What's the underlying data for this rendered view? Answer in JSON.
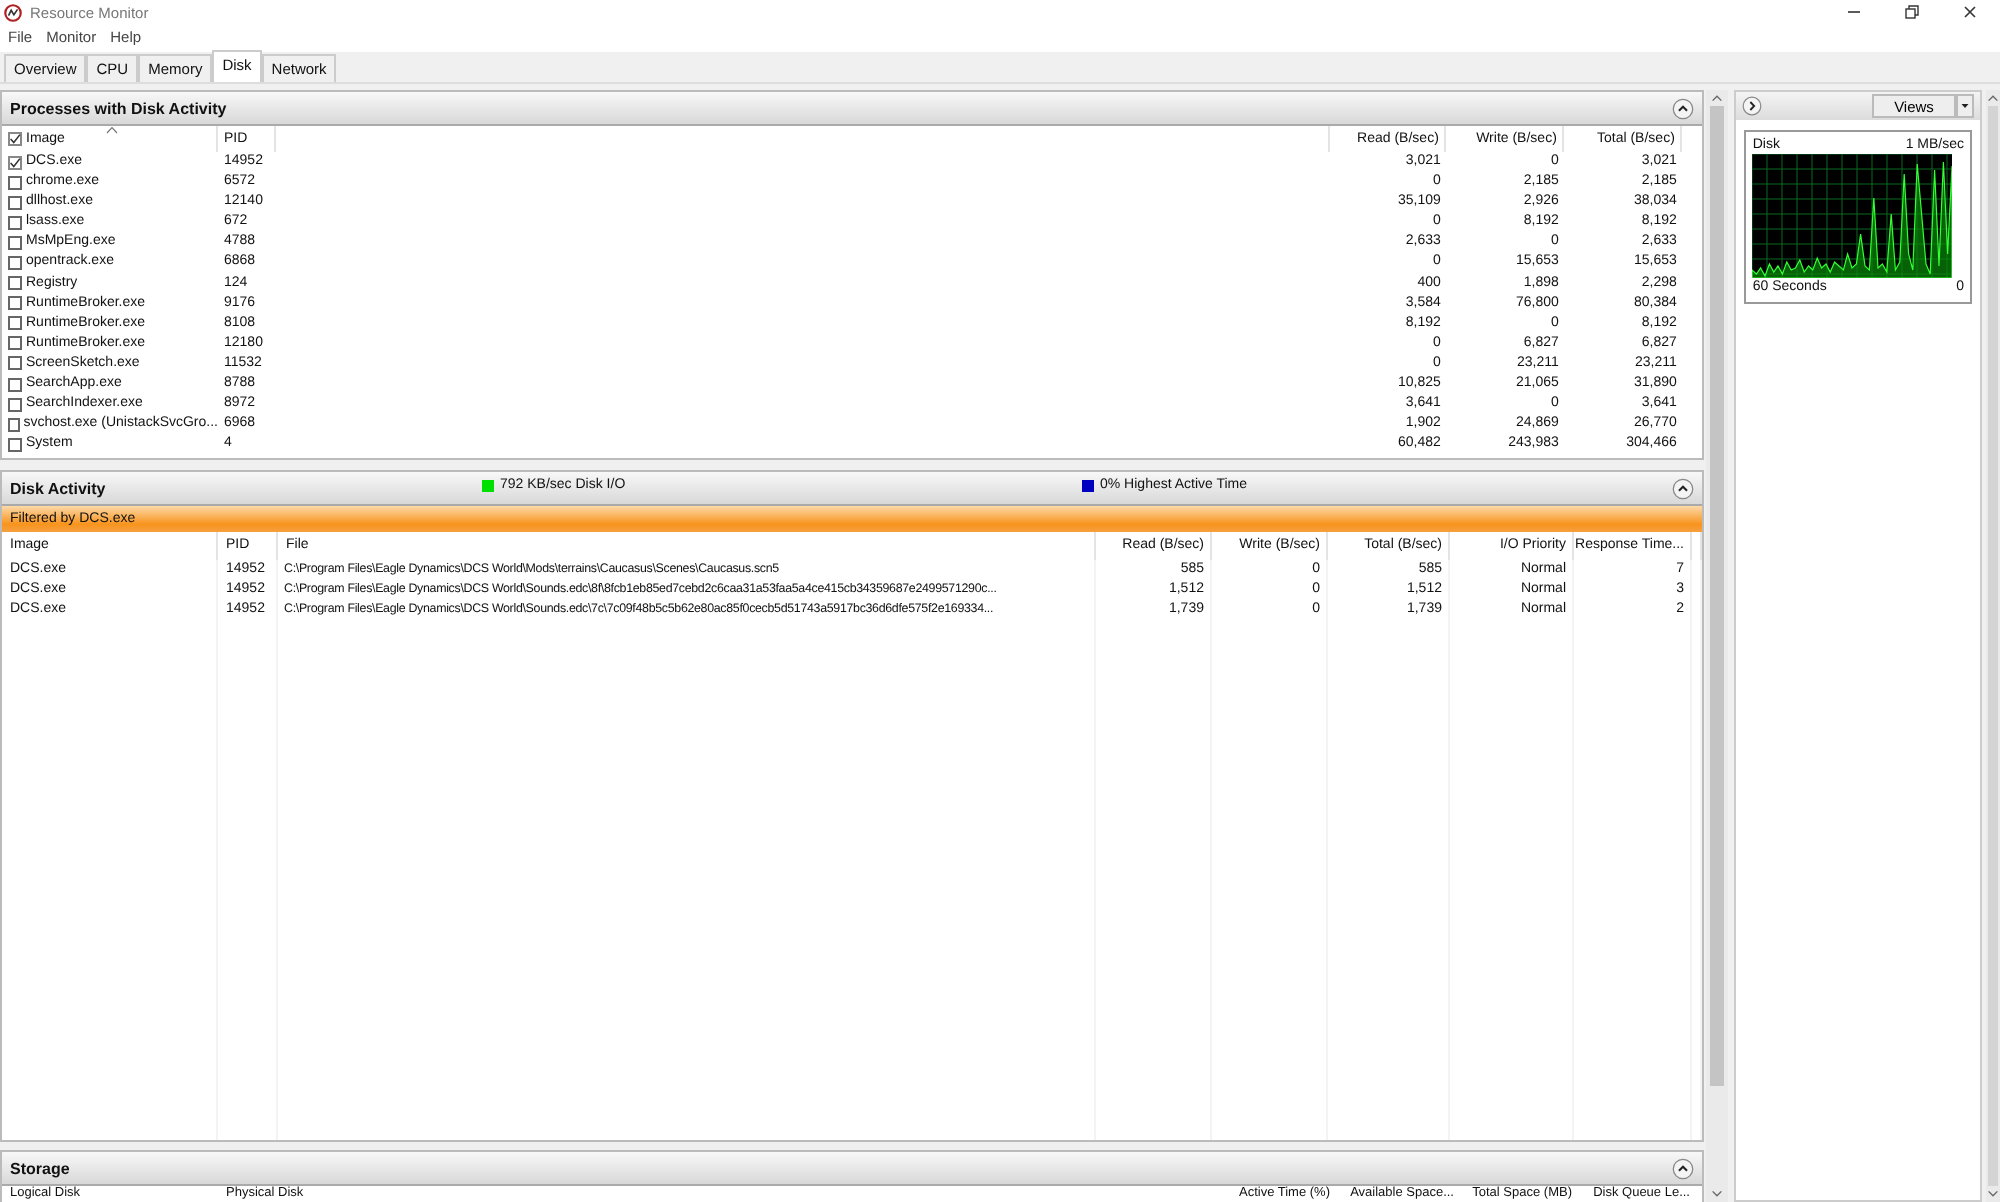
{
  "window": {
    "title": "Resource Monitor"
  },
  "menu": [
    "File",
    "Monitor",
    "Help"
  ],
  "tabs": [
    {
      "label": "Overview",
      "selected": false
    },
    {
      "label": "CPU",
      "selected": false
    },
    {
      "label": "Memory",
      "selected": false
    },
    {
      "label": "Disk",
      "selected": true
    },
    {
      "label": "Network",
      "selected": false
    }
  ],
  "processes": {
    "title": "Processes with Disk Activity",
    "all_checked": true,
    "columns": [
      "Image",
      "PID",
      "Read (B/sec)",
      "Write (B/sec)",
      "Total (B/sec)"
    ],
    "rows": [
      {
        "checked": true,
        "image": "DCS.exe",
        "pid": "14952",
        "read": "3,021",
        "write": "0",
        "total": "3,021"
      },
      {
        "checked": false,
        "image": "chrome.exe",
        "pid": "6572",
        "read": "0",
        "write": "2,185",
        "total": "2,185"
      },
      {
        "checked": false,
        "image": "dllhost.exe",
        "pid": "12140",
        "read": "35,109",
        "write": "2,926",
        "total": "38,034"
      },
      {
        "checked": false,
        "image": "lsass.exe",
        "pid": "672",
        "read": "0",
        "write": "8,192",
        "total": "8,192"
      },
      {
        "checked": false,
        "image": "MsMpEng.exe",
        "pid": "4788",
        "read": "2,633",
        "write": "0",
        "total": "2,633"
      },
      {
        "checked": false,
        "image": "opentrack.exe",
        "pid": "6868",
        "read": "0",
        "write": "15,653",
        "total": "15,653"
      },
      {
        "checked": false,
        "image": "Registry",
        "pid": "124",
        "read": "400",
        "write": "1,898",
        "total": "2,298"
      },
      {
        "checked": false,
        "image": "RuntimeBroker.exe",
        "pid": "9176",
        "read": "3,584",
        "write": "76,800",
        "total": "80,384"
      },
      {
        "checked": false,
        "image": "RuntimeBroker.exe",
        "pid": "8108",
        "read": "8,192",
        "write": "0",
        "total": "8,192"
      },
      {
        "checked": false,
        "image": "RuntimeBroker.exe",
        "pid": "12180",
        "read": "0",
        "write": "6,827",
        "total": "6,827"
      },
      {
        "checked": false,
        "image": "ScreenSketch.exe",
        "pid": "11532",
        "read": "0",
        "write": "23,211",
        "total": "23,211"
      },
      {
        "checked": false,
        "image": "SearchApp.exe",
        "pid": "8788",
        "read": "10,825",
        "write": "21,065",
        "total": "31,890"
      },
      {
        "checked": false,
        "image": "SearchIndexer.exe",
        "pid": "8972",
        "read": "3,641",
        "write": "0",
        "total": "3,641"
      },
      {
        "checked": false,
        "image": "svchost.exe (UnistackSvcGro...",
        "pid": "6968",
        "read": "1,902",
        "write": "24,869",
        "total": "26,770"
      },
      {
        "checked": false,
        "image": "System",
        "pid": "4",
        "read": "60,482",
        "write": "243,983",
        "total": "304,466"
      }
    ]
  },
  "disk_activity": {
    "title": "Disk Activity",
    "legend": [
      {
        "label": "792 KB/sec Disk I/O",
        "color": "#00e000"
      },
      {
        "label": "0% Highest Active Time",
        "color": "#0000c0"
      }
    ],
    "filter": "Filtered by DCS.exe",
    "columns": [
      "Image",
      "PID",
      "File",
      "Read (B/sec)",
      "Write (B/sec)",
      "Total (B/sec)",
      "I/O Priority",
      "Response Time..."
    ],
    "rows": [
      {
        "image": "DCS.exe",
        "pid": "14952",
        "file": "C:\\Program Files\\Eagle Dynamics\\DCS World\\Mods\\terrains\\Caucasus\\Scenes\\Caucasus.scn5",
        "read": "585",
        "write": "0",
        "total": "585",
        "priority": "Normal",
        "response": "7"
      },
      {
        "image": "DCS.exe",
        "pid": "14952",
        "file": "C:\\Program Files\\Eagle Dynamics\\DCS World\\Sounds.edc\\8f\\8fcb1eb85ed7cebd2c6caa31a53faa5a4ce415cb34359687e2499571290c...",
        "read": "1,512",
        "write": "0",
        "total": "1,512",
        "priority": "Normal",
        "response": "3"
      },
      {
        "image": "DCS.exe",
        "pid": "14952",
        "file": "C:\\Program Files\\Eagle Dynamics\\DCS World\\Sounds.edc\\7c\\7c09f48b5c5b62e80ac85f0cecb5d51743a5917bc36d6dfe575f2e169334...",
        "read": "1,739",
        "write": "0",
        "total": "1,739",
        "priority": "Normal",
        "response": "2"
      }
    ]
  },
  "storage": {
    "title": "Storage",
    "columns": [
      "Logical Disk",
      "Physical Disk",
      "Active Time (%)",
      "Available Space...",
      "Total Space (MB)",
      "Disk Queue Le..."
    ]
  },
  "side_panel": {
    "views_button": "Views",
    "graph": {
      "title": "Disk",
      "scale_max": "1 MB/sec",
      "time_span": "60 Seconds",
      "scale_min": "0"
    }
  }
}
